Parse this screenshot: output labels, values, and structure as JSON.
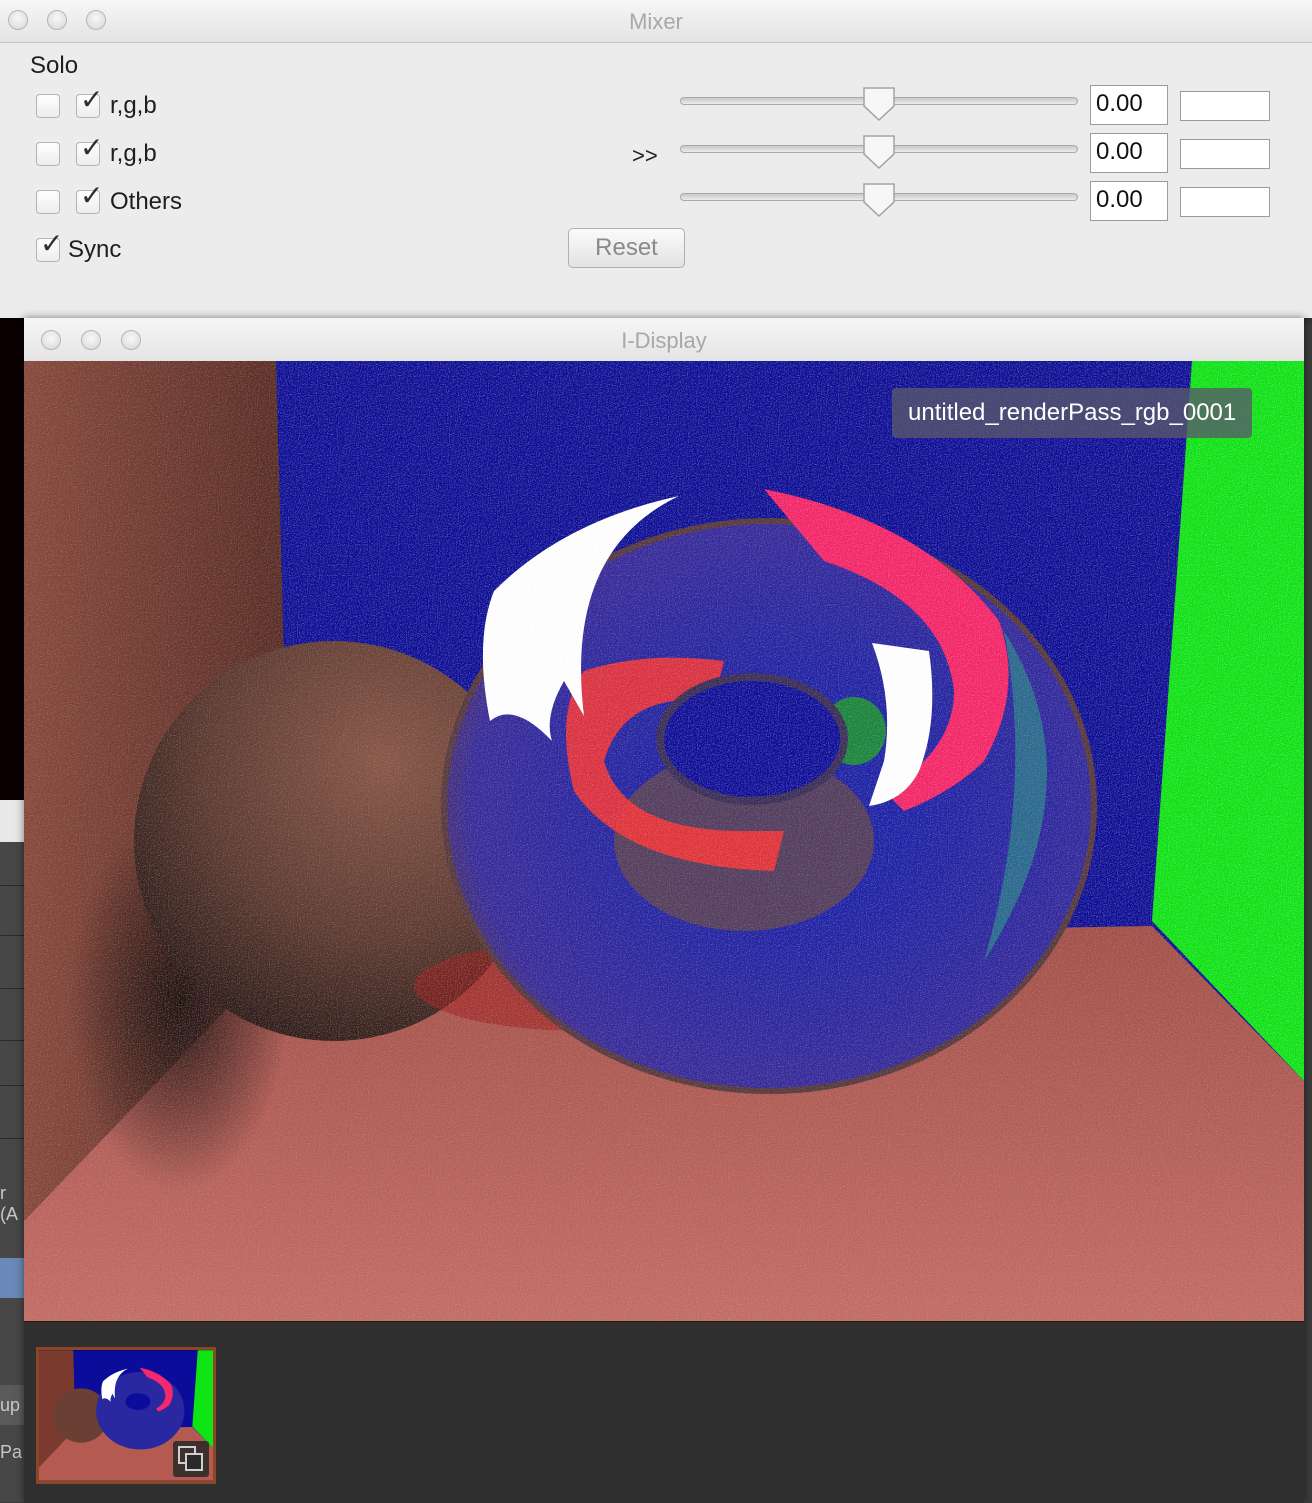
{
  "background_app": {
    "fragments": [
      "r (A",
      "up",
      "Pa"
    ]
  },
  "mixer": {
    "title": "Mixer",
    "solo_label": "Solo",
    "channels": [
      {
        "label": "r,g,b",
        "solo": false,
        "enabled": true,
        "value": "0.00",
        "slider_fraction": 0.5
      },
      {
        "label": "r,g,b",
        "solo": false,
        "enabled": true,
        "value": "0.00",
        "slider_fraction": 0.5
      },
      {
        "label": "Others",
        "solo": false,
        "enabled": true,
        "value": "0.00",
        "slider_fraction": 0.5
      }
    ],
    "sync_label": "Sync",
    "sync_checked": true,
    "expand_label": ">>",
    "reset_label": "Reset"
  },
  "display": {
    "title": "I-Display",
    "render_pass_label": "untitled_renderPass_rgb_0001",
    "scene_colors": {
      "left_wall": "#7a3b2e",
      "back_wall": "#0b0d9a",
      "right_wall": "#0fe414",
      "floor": "#b45a50",
      "sphere": "#6a4035",
      "torus_pink": "#f4286c",
      "torus_white": "#ffffff"
    },
    "thumbnail_icon": "layers-icon"
  }
}
